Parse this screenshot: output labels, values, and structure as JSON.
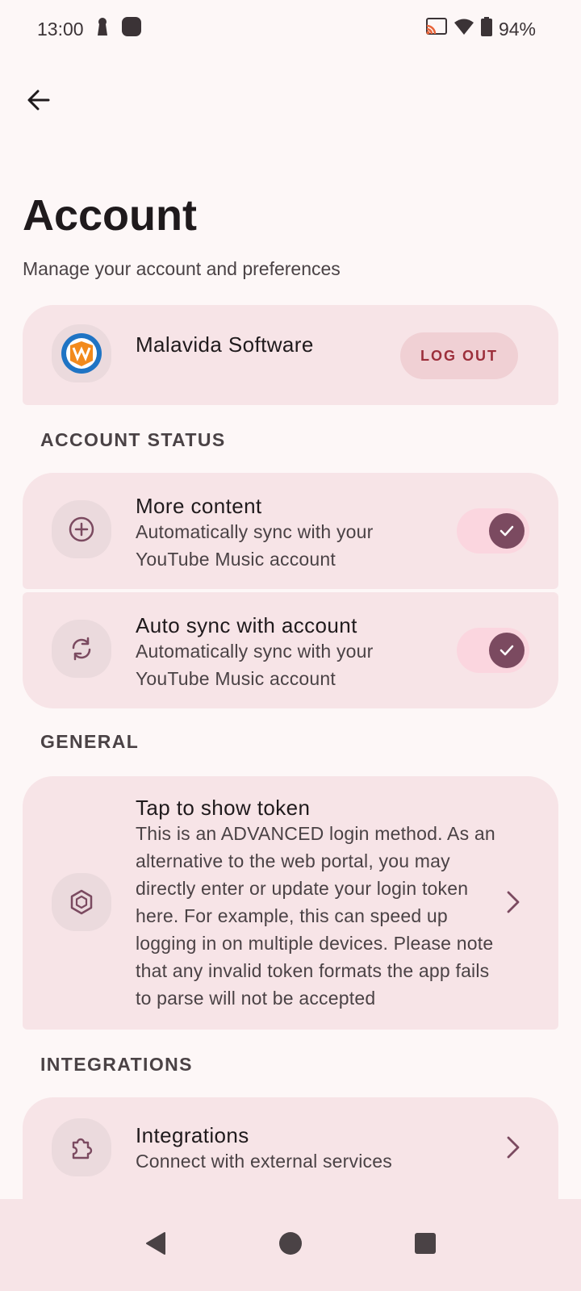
{
  "status_bar": {
    "time": "13:00",
    "battery": "94%",
    "icons": [
      "keyhole-icon",
      "app-icon",
      "cast-icon",
      "wifi-icon",
      "battery-icon"
    ]
  },
  "header": {
    "title": "Account",
    "subtitle": "Manage your account and preferences"
  },
  "account": {
    "name": "Malavida Software",
    "logout_label": "LOG OUT"
  },
  "sections": {
    "account_status": "ACCOUNT STATUS",
    "general": "GENERAL",
    "integrations": "INTEGRATIONS"
  },
  "rows": {
    "more_content": {
      "title": "More content",
      "subtitle": "Automatically sync with your YouTube Music account",
      "enabled": true
    },
    "auto_sync": {
      "title": "Auto sync with account",
      "subtitle": "Automatically sync with your YouTube Music account",
      "enabled": true
    },
    "token": {
      "title": "Tap to show token",
      "subtitle": "This is an ADVANCED login method. As an alternative to the web portal, you may directly enter or update your login token here. For example, this can speed up logging in on multiple devices. Please note that any invalid token formats the app fails to parse will not be accepted"
    },
    "integrations": {
      "title": "Integrations",
      "subtitle": "Connect with external services"
    }
  },
  "colors": {
    "accent": "#7b4a60",
    "card": "#f7e4e7",
    "background": "#fdf7f7",
    "logout_text": "#9c2f3b"
  }
}
